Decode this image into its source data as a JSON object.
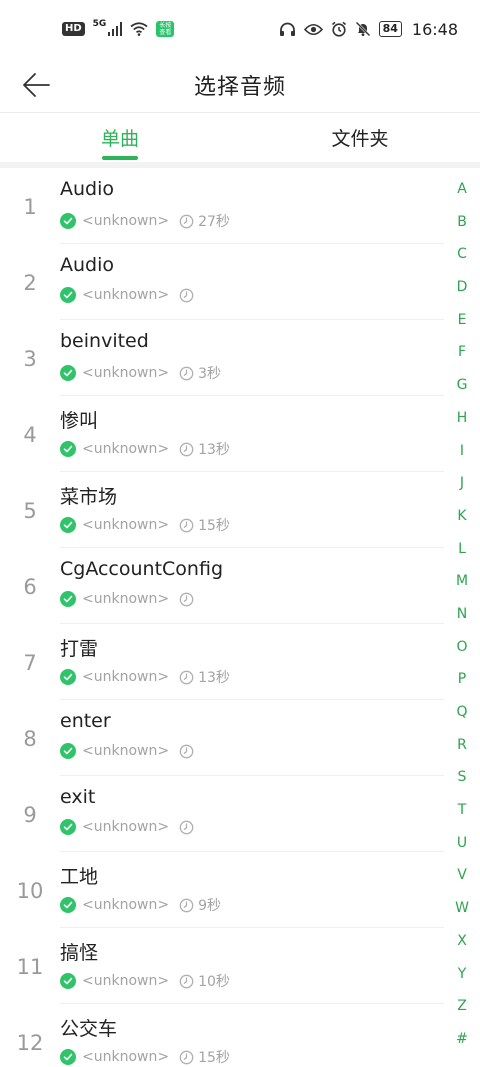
{
  "status_bar": {
    "hd": "HD",
    "net": "5G",
    "badge_top": "长按",
    "badge_bottom": "查看",
    "battery": "84",
    "time": "16:48"
  },
  "header": {
    "title": "选择音频"
  },
  "tabs": [
    {
      "label": "单曲",
      "active": true
    },
    {
      "label": "文件夹",
      "active": false
    }
  ],
  "songs": [
    {
      "index": "1",
      "title": "Audio",
      "artist": "<unknown>",
      "duration": "27秒"
    },
    {
      "index": "2",
      "title": "Audio",
      "artist": "<unknown>",
      "duration": ""
    },
    {
      "index": "3",
      "title": "beinvited",
      "artist": "<unknown>",
      "duration": "3秒"
    },
    {
      "index": "4",
      "title": "惨叫",
      "artist": "<unknown>",
      "duration": "13秒"
    },
    {
      "index": "5",
      "title": "菜市场",
      "artist": "<unknown>",
      "duration": "15秒"
    },
    {
      "index": "6",
      "title": "CgAccountConfig",
      "artist": "<unknown>",
      "duration": ""
    },
    {
      "index": "7",
      "title": "打雷",
      "artist": "<unknown>",
      "duration": "13秒"
    },
    {
      "index": "8",
      "title": "enter",
      "artist": "<unknown>",
      "duration": ""
    },
    {
      "index": "9",
      "title": "exit",
      "artist": "<unknown>",
      "duration": ""
    },
    {
      "index": "10",
      "title": "工地",
      "artist": "<unknown>",
      "duration": "9秒"
    },
    {
      "index": "11",
      "title": "搞怪",
      "artist": "<unknown>",
      "duration": "10秒"
    },
    {
      "index": "12",
      "title": "公交车",
      "artist": "<unknown>",
      "duration": "15秒"
    }
  ],
  "alphabet": [
    "A",
    "B",
    "C",
    "D",
    "E",
    "F",
    "G",
    "H",
    "I",
    "J",
    "K",
    "L",
    "M",
    "N",
    "O",
    "P",
    "Q",
    "R",
    "S",
    "T",
    "U",
    "V",
    "W",
    "X",
    "Y",
    "Z",
    "#"
  ],
  "colors": {
    "accent": "#2fb35a",
    "check": "#2fc46a",
    "index_letter": "#2fa44f"
  }
}
